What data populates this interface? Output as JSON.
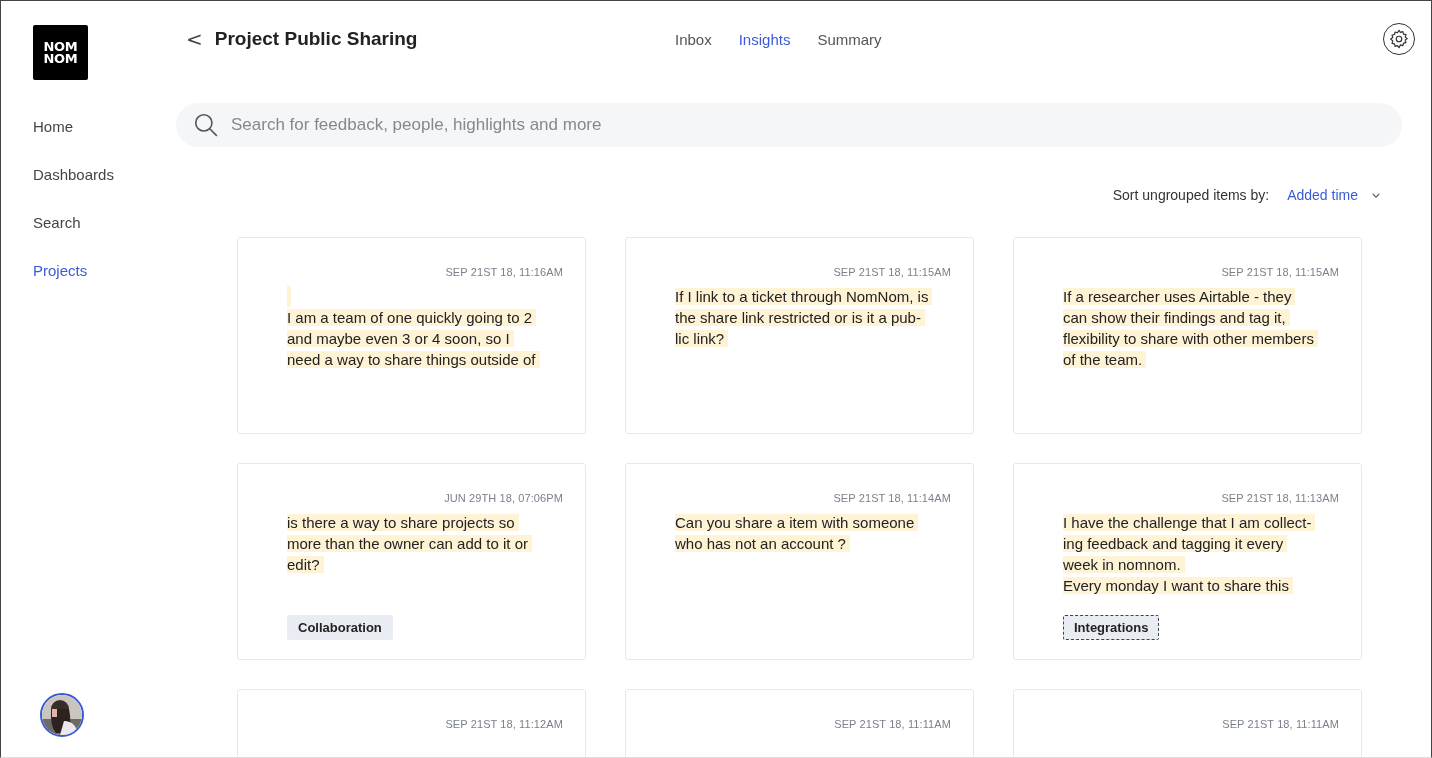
{
  "logo": {
    "lines": [
      "NOM",
      "NOM"
    ]
  },
  "sidebar": {
    "items": [
      {
        "label": "Home",
        "selected": false
      },
      {
        "label": "Dashboards",
        "selected": false
      },
      {
        "label": "Search",
        "selected": false
      },
      {
        "label": "Projects",
        "selected": true
      }
    ]
  },
  "header": {
    "back": "<",
    "title": "Project Public Sharing"
  },
  "tabs": [
    {
      "label": "Inbox",
      "selected": false
    },
    {
      "label": "Insights",
      "selected": true
    },
    {
      "label": "Summary",
      "selected": false
    }
  ],
  "search": {
    "placeholder": "Search for feedback, people, highlights and more"
  },
  "sort": {
    "label": "Sort ungrouped items by:",
    "value": "Added time"
  },
  "cards": [
    {
      "date": "SEP 21ST 18, 11:16AM",
      "blank_first_line": true,
      "lines": [
        "I am a team of one quickly going to 2",
        "and maybe even 3 or 4 soon, so I",
        "need a way to share things outside of"
      ]
    },
    {
      "date": "SEP 21ST 18, 11:15AM",
      "blank_first_line": false,
      "lines": [
        "If I link to a ticket through NomNom, is",
        "the share link restricted or is it a pub-",
        "lic link?"
      ]
    },
    {
      "date": "SEP 21ST 18, 11:15AM",
      "blank_first_line": false,
      "lines": [
        "If a researcher uses Airtable - they",
        "can show their findings and tag it,",
        "flexibility to share with other members",
        "of the team."
      ]
    },
    {
      "date": "JUN 29TH 18, 07:06PM",
      "blank_first_line": false,
      "lines": [
        "is there a way to share projects so",
        "more than the owner can add to it or",
        "edit?"
      ],
      "tags": [
        {
          "label": "Collaboration",
          "focused": false
        }
      ]
    },
    {
      "date": "SEP 21ST 18, 11:14AM",
      "blank_first_line": false,
      "lines": [
        "Can you share a item with someone",
        "who has not an account ?"
      ]
    },
    {
      "date": "SEP 21ST 18, 11:13AM",
      "blank_first_line": false,
      "lines": [
        "I have the challenge that I am collect-",
        "ing feedback and tagging it every",
        "week in nomnom.",
        "Every monday I want to share this"
      ],
      "tags": [
        {
          "label": "Integrations",
          "focused": true
        }
      ]
    },
    {
      "date": "SEP 21ST 18, 11:12AM",
      "blank_first_line": false
    },
    {
      "date": "SEP 21ST 18, 11:11AM",
      "blank_first_line": false
    },
    {
      "date": "SEP 21ST 18, 11:11AM",
      "blank_first_line": false
    }
  ]
}
